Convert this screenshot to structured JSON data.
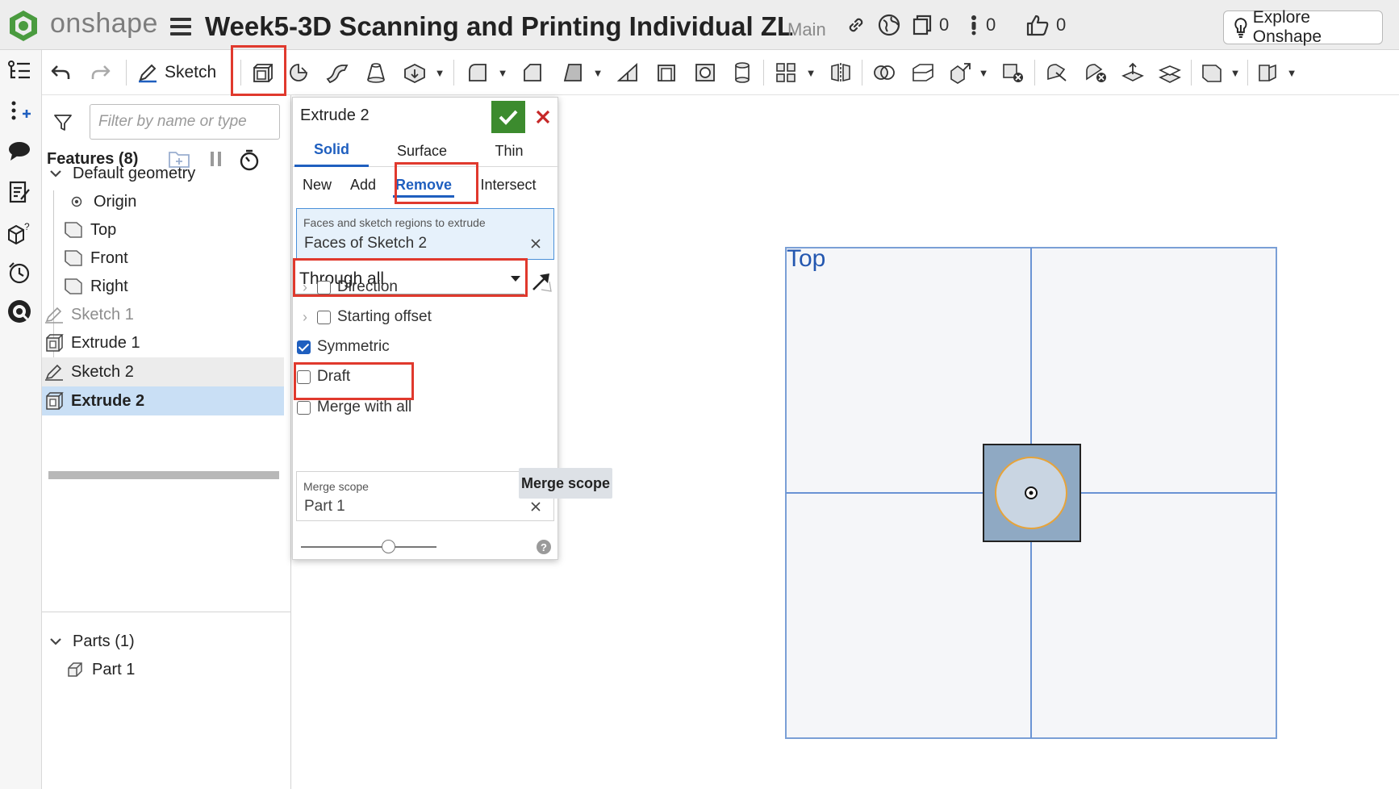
{
  "app": {
    "logo_text": "onshape"
  },
  "document": {
    "title": "Week5-3D Scanning and Printing Individual ZL",
    "branch": "Main"
  },
  "topbar": {
    "versions_count": "0",
    "notifications_count": "0",
    "likes_count": "0",
    "explore_button": "Explore Onshape"
  },
  "toolbar": {
    "sketch_label": "Sketch"
  },
  "feature_panel": {
    "filter_placeholder": "Filter by name or type",
    "features_header": "Features (8)",
    "tree": [
      {
        "label": "Default geometry"
      },
      {
        "label": "Origin"
      },
      {
        "label": "Top"
      },
      {
        "label": "Front"
      },
      {
        "label": "Right"
      },
      {
        "label": "Sketch 1"
      },
      {
        "label": "Extrude 1"
      },
      {
        "label": "Sketch 2"
      },
      {
        "label": "Extrude 2"
      }
    ],
    "parts_header": "Parts (1)",
    "parts": [
      {
        "label": "Part 1"
      }
    ]
  },
  "dialog": {
    "title": "Extrude 2",
    "tabs": [
      "Solid",
      "Surface",
      "Thin"
    ],
    "active_tab": "Solid",
    "operations": [
      "New",
      "Add",
      "Remove",
      "Intersect"
    ],
    "active_operation": "Remove",
    "faces_label": "Faces and sketch regions to extrude",
    "faces_value": "Faces of Sketch 2",
    "end_type": "Through all",
    "options": [
      {
        "label": "Direction",
        "checked": false
      },
      {
        "label": "Starting offset",
        "checked": false
      },
      {
        "label": "Symmetric",
        "checked": true
      },
      {
        "label": "Draft",
        "checked": false
      },
      {
        "label": "Merge with all",
        "checked": false
      }
    ],
    "merge_scope_label": "Merge scope",
    "merge_scope_value": "Part 1",
    "tooltip": "Merge scope"
  },
  "viewport": {
    "plane_label": "Top"
  },
  "colors": {
    "accent": "#1f5fbf",
    "highlight": "#e0392d",
    "ok_green": "#3c8b2e",
    "selected_row": "#c9dff5"
  }
}
